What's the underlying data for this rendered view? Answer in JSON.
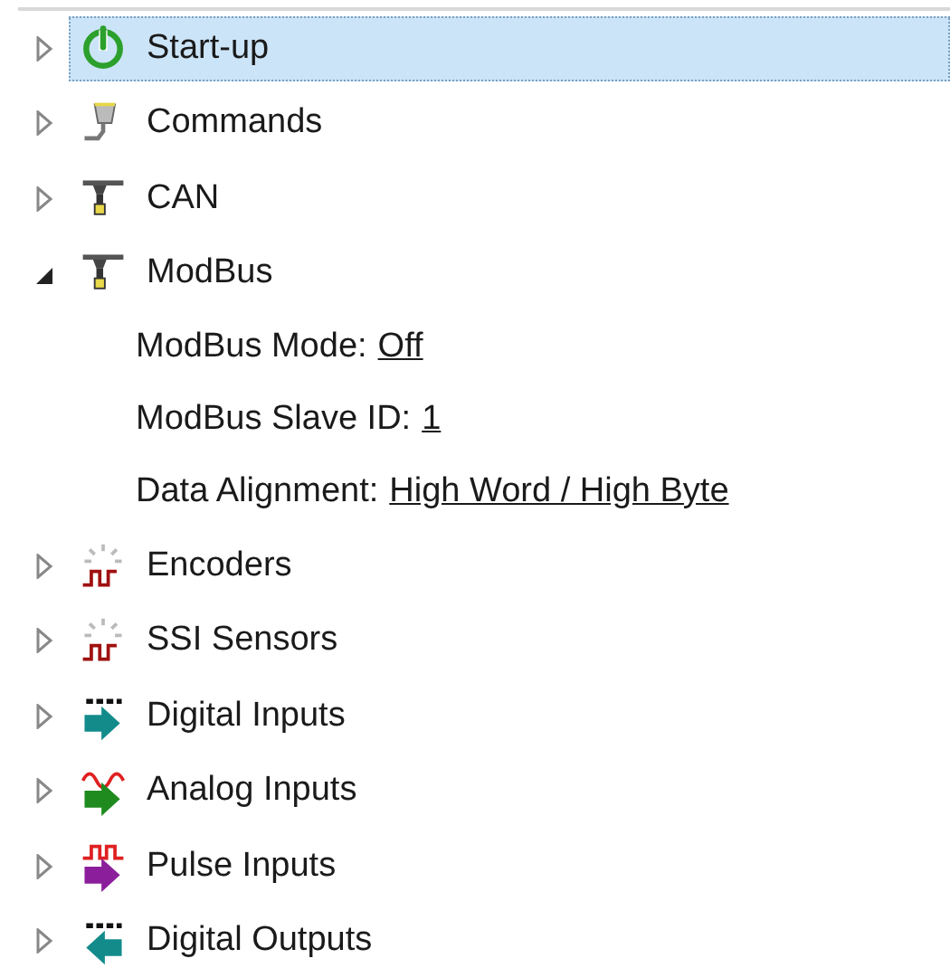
{
  "tree": {
    "items": [
      {
        "label": "Start-up",
        "kind": "power",
        "expanded": false,
        "selected": true
      },
      {
        "label": "Commands",
        "kind": "serial",
        "expanded": false,
        "selected": false
      },
      {
        "label": "CAN",
        "kind": "bus",
        "expanded": false,
        "selected": false
      },
      {
        "label": "ModBus",
        "kind": "bus",
        "expanded": true,
        "selected": false,
        "children": [
          {
            "label": "ModBus Mode:",
            "value": "Off"
          },
          {
            "label": "ModBus Slave ID:",
            "value": "1"
          },
          {
            "label": "Data Alignment:",
            "value": "High Word / High Byte"
          }
        ]
      },
      {
        "label": "Encoders",
        "kind": "encoder",
        "expanded": false,
        "selected": false
      },
      {
        "label": "SSI Sensors",
        "kind": "encoder",
        "expanded": false,
        "selected": false
      },
      {
        "label": "Digital Inputs",
        "kind": "digital-in",
        "expanded": false,
        "selected": false
      },
      {
        "label": "Analog Inputs",
        "kind": "analog-in",
        "expanded": false,
        "selected": false
      },
      {
        "label": "Pulse Inputs",
        "kind": "pulse-in",
        "expanded": false,
        "selected": false
      },
      {
        "label": "Digital Outputs",
        "kind": "digital-out",
        "expanded": false,
        "selected": false
      }
    ]
  }
}
